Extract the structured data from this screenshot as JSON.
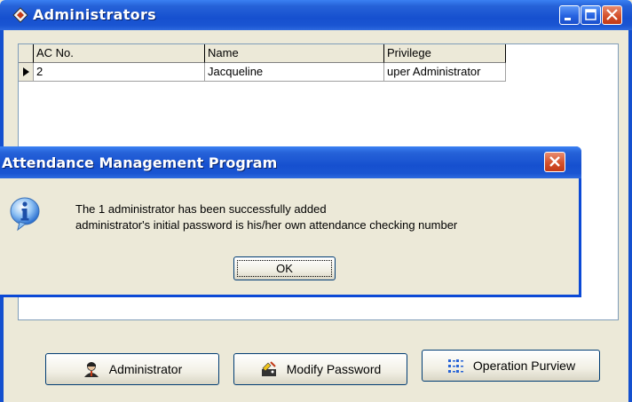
{
  "main_window": {
    "title": "Administrators",
    "icon": "app-diamond-icon",
    "controls": [
      "minimize-icon",
      "maximize-icon",
      "close-icon"
    ]
  },
  "grid": {
    "columns": [
      "AC No.",
      "Name",
      "Privilege"
    ],
    "rows": [
      {
        "ac_no": "2",
        "name": "Jacqueline",
        "privilege": "uper Administrator"
      }
    ]
  },
  "dialog": {
    "title": "Attendance Management Program",
    "icon": "info-icon",
    "message_line1": "The 1 administrator has been successfully added",
    "message_line2": "administrator's initial password is his/her own attendance checking number",
    "ok_label": "OK"
  },
  "buttons": {
    "administrator": "Administrator",
    "modify_password": "Modify Password",
    "operation_purview": "Operation Purview"
  },
  "colors": {
    "titlebar_blue": "#1650cf",
    "close_red": "#d4512c",
    "window_bg": "#ece9d8"
  }
}
